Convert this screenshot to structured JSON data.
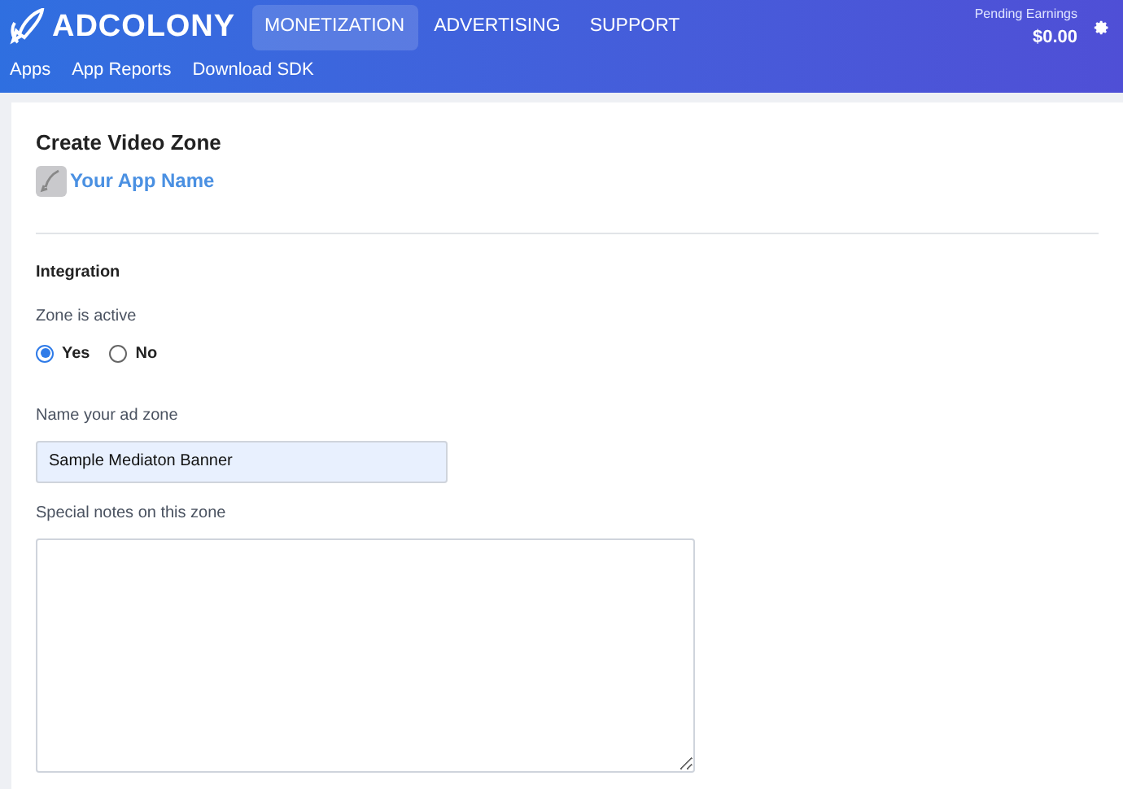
{
  "header": {
    "logo": "ADCOLONY",
    "nav": [
      {
        "label": "MONETIZATION",
        "selected": true
      },
      {
        "label": "ADVERTISING",
        "selected": false
      },
      {
        "label": "SUPPORT",
        "selected": false
      }
    ],
    "earnings_label": "Pending Earnings",
    "earnings_value": "$0.00"
  },
  "subnav": [
    "Apps",
    "App Reports",
    "Download SDK"
  ],
  "page": {
    "title": "Create Video Zone",
    "app_name": "Your App Name",
    "section": "Integration",
    "active_label": "Zone is active",
    "active_options": [
      {
        "label": "Yes",
        "selected": true
      },
      {
        "label": "No",
        "selected": false
      }
    ],
    "name_label": "Name your ad zone",
    "name_value": "Sample Mediaton Banner",
    "notes_label": "Special notes on this zone"
  }
}
